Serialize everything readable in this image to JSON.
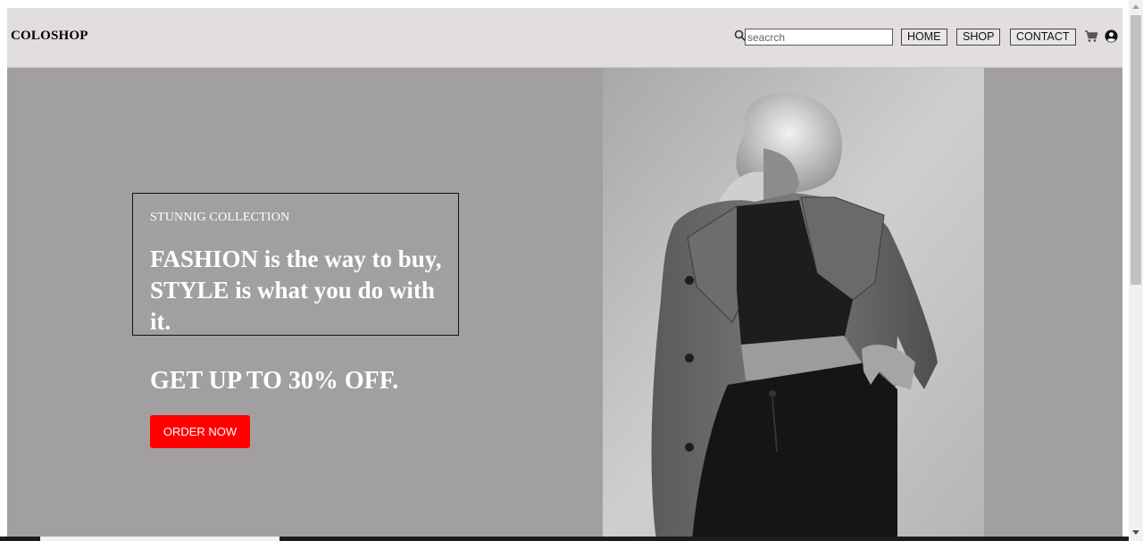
{
  "navbar": {
    "brand": "COLOSHOP",
    "search": {
      "placeholder": "seacrch",
      "icon": "search-icon"
    },
    "links": [
      "HOME",
      "SHOP",
      "CONTACT"
    ],
    "icons": [
      "cart-icon",
      "user-circle-icon"
    ]
  },
  "hero": {
    "eyebrow": "STUNNIG COLLECTION",
    "headline": "FASHION is the way to buy, STYLE is what you do with it.",
    "offer": "GET UP TO 30% OFF.",
    "cta_label": "ORDER NOW"
  },
  "colors": {
    "navbar_bg": "#e2dede",
    "hero_bg": "#a19fa1",
    "cta_bg": "#ff0000",
    "text_light": "#ffffff"
  }
}
